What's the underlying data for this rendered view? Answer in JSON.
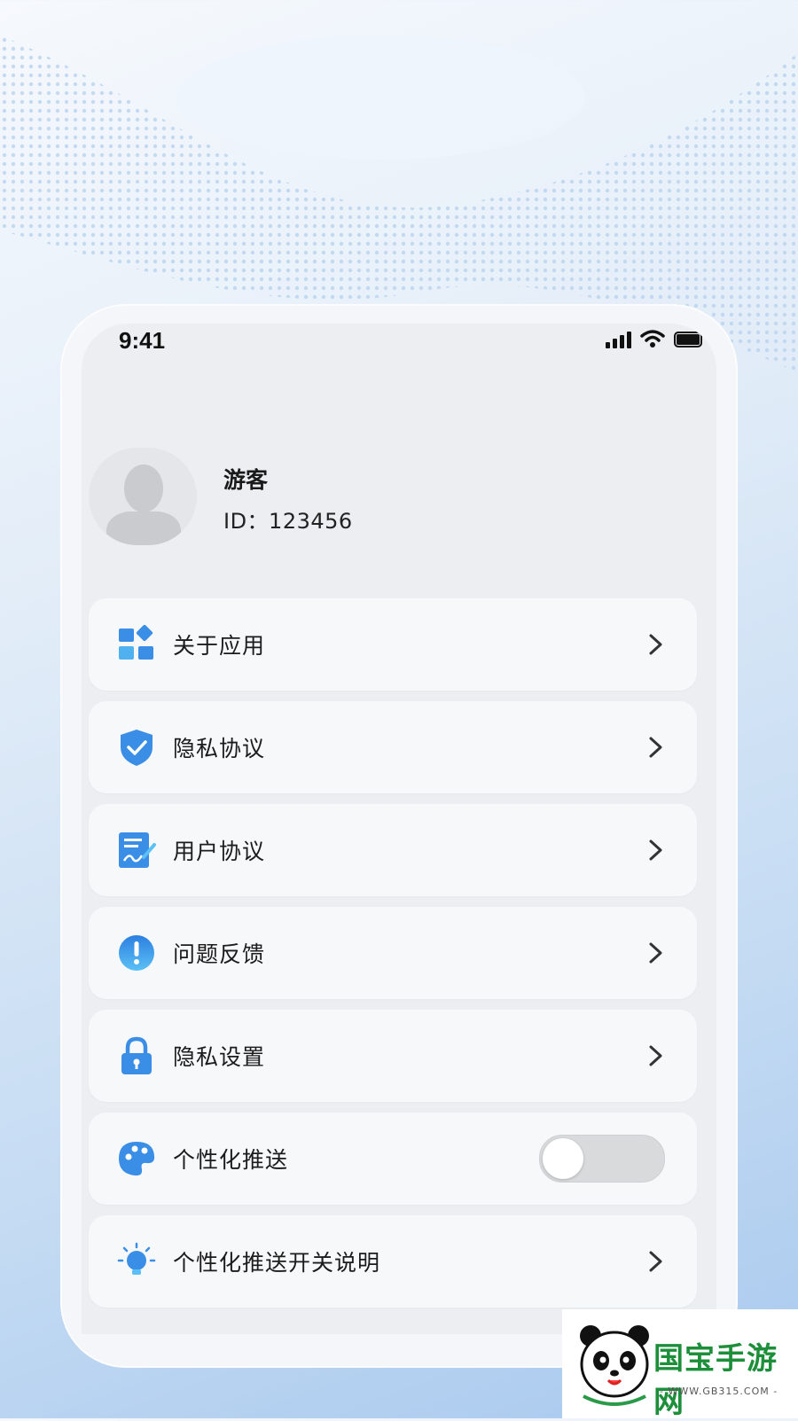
{
  "status_bar": {
    "time": "9:41"
  },
  "profile": {
    "name": "游客",
    "id_text": "ID：123456"
  },
  "menu": {
    "items": [
      {
        "label": "关于应用",
        "icon": "grid-apps-icon",
        "accessory": "chevron"
      },
      {
        "label": "隐私协议",
        "icon": "shield-check-icon",
        "accessory": "chevron"
      },
      {
        "label": "用户协议",
        "icon": "document-sign-icon",
        "accessory": "chevron"
      },
      {
        "label": "问题反馈",
        "icon": "exclamation-circle-icon",
        "accessory": "chevron"
      },
      {
        "label": "隐私设置",
        "icon": "lock-icon",
        "accessory": "chevron"
      },
      {
        "label": "个性化推送",
        "icon": "palette-icon",
        "accessory": "toggle",
        "toggle_on": false
      },
      {
        "label": "个性化推送开关说明",
        "icon": "lightbulb-icon",
        "accessory": "chevron"
      }
    ]
  },
  "watermark": {
    "title": "国宝手游网",
    "subtitle": "- WWW.GB315.COM -"
  },
  "colors": {
    "accent": "#3a8ee6",
    "toggle_off": "#d9dadc",
    "watermark_green": "#1d8f3a"
  }
}
